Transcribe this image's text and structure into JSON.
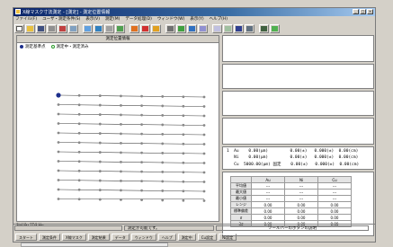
{
  "window": {
    "title": "X線マスク寸法測定 - [測定] - 測定位置情報"
  },
  "menu": {
    "items": [
      "ファイル(F)",
      "ユーザ・測定条件(S)",
      "表示(V)",
      "測定(M)",
      "データ処理(D)",
      "ウィンドウ(W)",
      "表示(Y)",
      "ヘルプ(H)"
    ]
  },
  "left_panel": {
    "title": "測定位置情報",
    "legend": [
      {
        "label": "測定基準点",
        "color": "#1c2e8c"
      },
      {
        "label": "測定中・測定済み",
        "color": "#2a9a2a"
      }
    ],
    "grid_rows": 12,
    "grid_cols": 8,
    "tab_label": "ShiftPo 7DS Mo"
  },
  "readout": {
    "rows": [
      "1  Au    0.00(μm)         0.00(±)   0.000(±)  0.00(cm)",
      "   Ni    0.00(μm)         0.00(±)   0.000(±)  0.00(cm)",
      "   Cu  5000.00(μm) 固定    0.00(±)   0.000(±)  0.00(cm)"
    ]
  },
  "table": {
    "columns": [
      "Au",
      "Ni",
      "Cu"
    ],
    "rows": [
      {
        "label": "平均値",
        "values": [
          "---",
          "---",
          "---"
        ]
      },
      {
        "label": "最大値",
        "values": [
          "---",
          "---",
          "---"
        ]
      },
      {
        "label": "最小値",
        "values": [
          "---",
          "---",
          "---"
        ]
      },
      {
        "label": "レンジ",
        "values": [
          "0.00",
          "0.00",
          "0.00"
        ]
      },
      {
        "label": "標準偏差",
        "values": [
          "0.00",
          "0.00",
          "0.00"
        ]
      },
      {
        "label": "σ",
        "values": [
          "0.00",
          "0.00",
          "0.00"
        ]
      },
      {
        "label": "3σ",
        "values": [
          "0.00",
          "0.00",
          "0.00"
        ]
      }
    ]
  },
  "status": {
    "left": "",
    "middle": "測定が可能です。",
    "right": "ツールバーのボタンの説明"
  },
  "taskbar": {
    "items": [
      "スタート",
      "測定条件",
      "X線マスク",
      "測定結果",
      "データ",
      "ウィンドウ",
      "ヘルプ",
      "測定中",
      "Cu設定",
      "Ni設定"
    ]
  },
  "colors": {
    "title_gradient_start": "#0a246a",
    "base_point": "#1c2e8c",
    "measured_point": "#2a9a2a"
  }
}
